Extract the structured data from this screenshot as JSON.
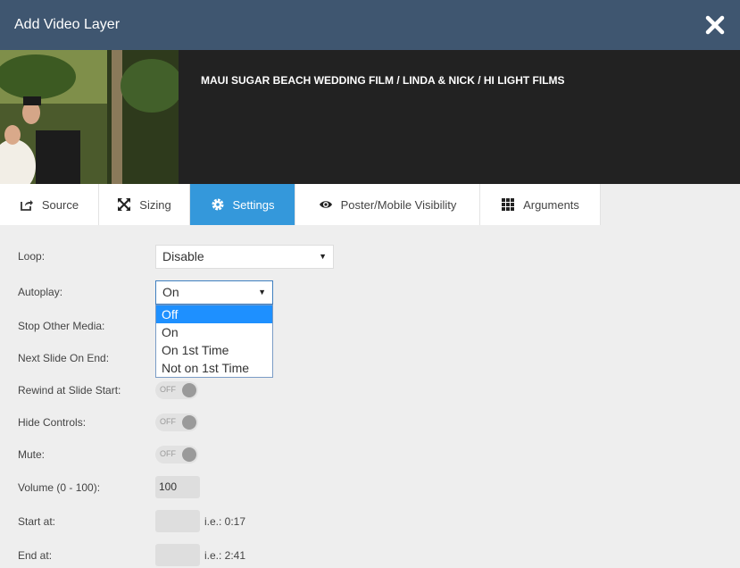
{
  "window": {
    "title": "Add Video Layer"
  },
  "video": {
    "title": "MAUI SUGAR BEACH WEDDING FILM / LINDA & NICK / HI LIGHT FILMS"
  },
  "tabs": [
    {
      "label": "Source",
      "icon": "share-icon"
    },
    {
      "label": "Sizing",
      "icon": "expand-icon"
    },
    {
      "label": "Settings",
      "icon": "gear-icon"
    },
    {
      "label": "Poster/Mobile Visibility",
      "icon": "eye-icon"
    },
    {
      "label": "Arguments",
      "icon": "grid-icon"
    }
  ],
  "active_tab": "Settings",
  "settings": {
    "loop": {
      "label": "Loop:",
      "value": "Disable"
    },
    "autoplay": {
      "label": "Autoplay:",
      "value": "On",
      "options": [
        "Off",
        "On",
        "On 1st Time",
        "Not on 1st Time"
      ],
      "highlighted": "Off"
    },
    "stop_other_media": {
      "label": "Stop Other Media:"
    },
    "next_slide_on_end": {
      "label": "Next Slide On End:"
    },
    "rewind": {
      "label": "Rewind at Slide Start:",
      "state": "OFF"
    },
    "hide_controls": {
      "label": "Hide Controls:",
      "state": "OFF"
    },
    "mute": {
      "label": "Mute:",
      "state": "OFF"
    },
    "volume": {
      "label": "Volume (0 - 100):",
      "value": "100"
    },
    "start_at": {
      "label": "Start at:",
      "value": "",
      "hint": "i.e.: 0:17"
    },
    "end_at": {
      "label": "End at:",
      "value": "",
      "hint": "i.e.: 2:41"
    }
  },
  "colors": {
    "header": "#3f5670",
    "accent": "#3498db",
    "highlight": "#1e90ff"
  }
}
